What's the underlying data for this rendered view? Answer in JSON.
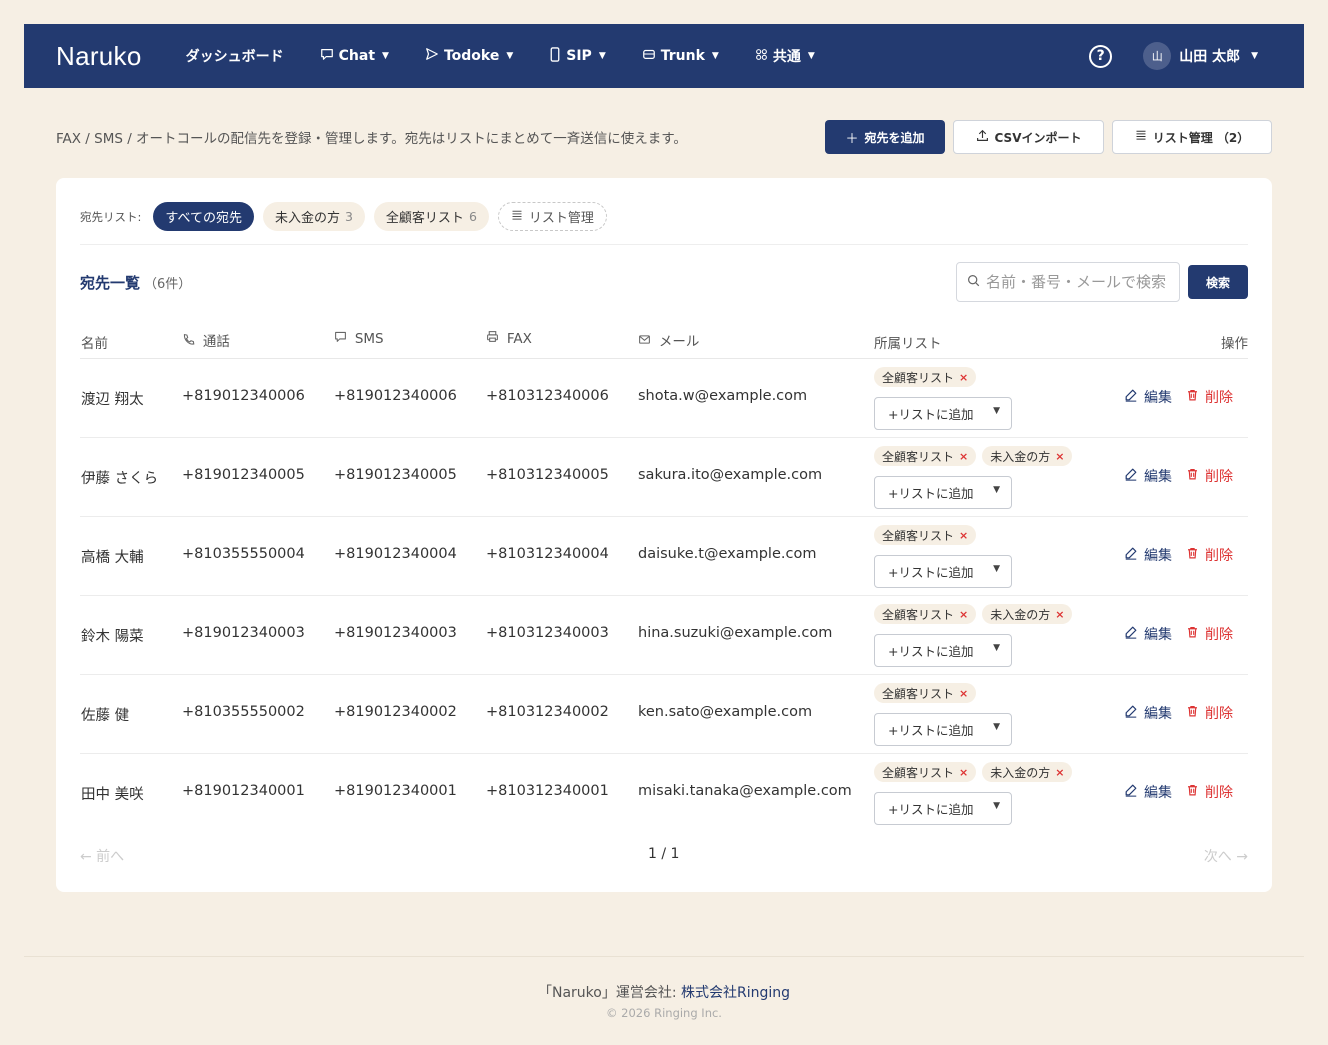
{
  "header": {
    "brand": "Naruko",
    "nav": [
      {
        "label": "ダッシュボード",
        "icon": "",
        "has_dropdown": false
      },
      {
        "label": "Chat",
        "icon": "chat-icon",
        "has_dropdown": true
      },
      {
        "label": "Todoke",
        "icon": "send-icon",
        "has_dropdown": true
      },
      {
        "label": "SIP",
        "icon": "phone-device-icon",
        "has_dropdown": true
      },
      {
        "label": "Trunk",
        "icon": "trunk-icon",
        "has_dropdown": true
      },
      {
        "label": "共通",
        "icon": "grid-icon",
        "has_dropdown": true
      }
    ],
    "help_label": "?",
    "user": {
      "avatar": "山",
      "name": "山田 太郎"
    }
  },
  "intro_text": "FAX / SMS / オートコールの配信先を登録・管理します。宛先はリストにまとめて一斉送信に使えます。",
  "actions": {
    "add_label": "宛先を追加",
    "csv_label": "CSVインポート",
    "list_manage_label": "リスト管理 （2）"
  },
  "filter": {
    "label": "宛先リスト:",
    "chips": [
      {
        "label": "すべての宛先",
        "count": "",
        "active": true
      },
      {
        "label": "未入金の方",
        "count": "3",
        "active": false
      },
      {
        "label": "全顧客リスト",
        "count": "6",
        "active": false
      }
    ],
    "manage_label": "リスト管理"
  },
  "list": {
    "title": "宛先一覧",
    "count": "（6件）",
    "search_placeholder": "名前・番号・メールで検索",
    "search_button": "検索"
  },
  "columns": {
    "name": "名前",
    "call": "通話",
    "sms": "SMS",
    "fax": "FAX",
    "mail": "メール",
    "lists": "所属リスト",
    "actions": "操作"
  },
  "rows": [
    {
      "name": "渡辺 翔太",
      "call": "+819012340006",
      "sms": "+819012340006",
      "fax": "+810312340006",
      "mail": "shota.w@example.com",
      "tags": [
        "全顧客リスト"
      ]
    },
    {
      "name": "伊藤 さくら",
      "call": "+819012340005",
      "sms": "+819012340005",
      "fax": "+810312340005",
      "mail": "sakura.ito@example.com",
      "tags": [
        "全顧客リスト",
        "未入金の方"
      ]
    },
    {
      "name": "高橋 大輔",
      "call": "+810355550004",
      "sms": "+819012340004",
      "fax": "+810312340004",
      "mail": "daisuke.t@example.com",
      "tags": [
        "全顧客リスト"
      ]
    },
    {
      "name": "鈴木 陽菜",
      "call": "+819012340003",
      "sms": "+819012340003",
      "fax": "+810312340003",
      "mail": "hina.suzuki@example.com",
      "tags": [
        "全顧客リスト",
        "未入金の方"
      ]
    },
    {
      "name": "佐藤 健",
      "call": "+810355550002",
      "sms": "+819012340002",
      "fax": "+810312340002",
      "mail": "ken.sato@example.com",
      "tags": [
        "全顧客リスト"
      ]
    },
    {
      "name": "田中 美咲",
      "call": "+819012340001",
      "sms": "+819012340001",
      "fax": "+810312340001",
      "mail": "misaki.tanaka@example.com",
      "tags": [
        "全顧客リスト",
        "未入金の方"
      ]
    }
  ],
  "row_labels": {
    "add_to_list": "+リストに追加",
    "edit": "編集",
    "delete": "削除",
    "tag_remove": "×"
  },
  "pagination": {
    "prev": "← 前へ",
    "info": "1 / 1",
    "next": "次へ →"
  },
  "footer": {
    "prefix": "「Naruko」運営会社:",
    "company": "株式会社Ringing",
    "copyright": "© 2026 Ringing Inc."
  },
  "colors": {
    "primary": "#233a70",
    "background": "#f6efe4",
    "danger": "#dd3333"
  }
}
